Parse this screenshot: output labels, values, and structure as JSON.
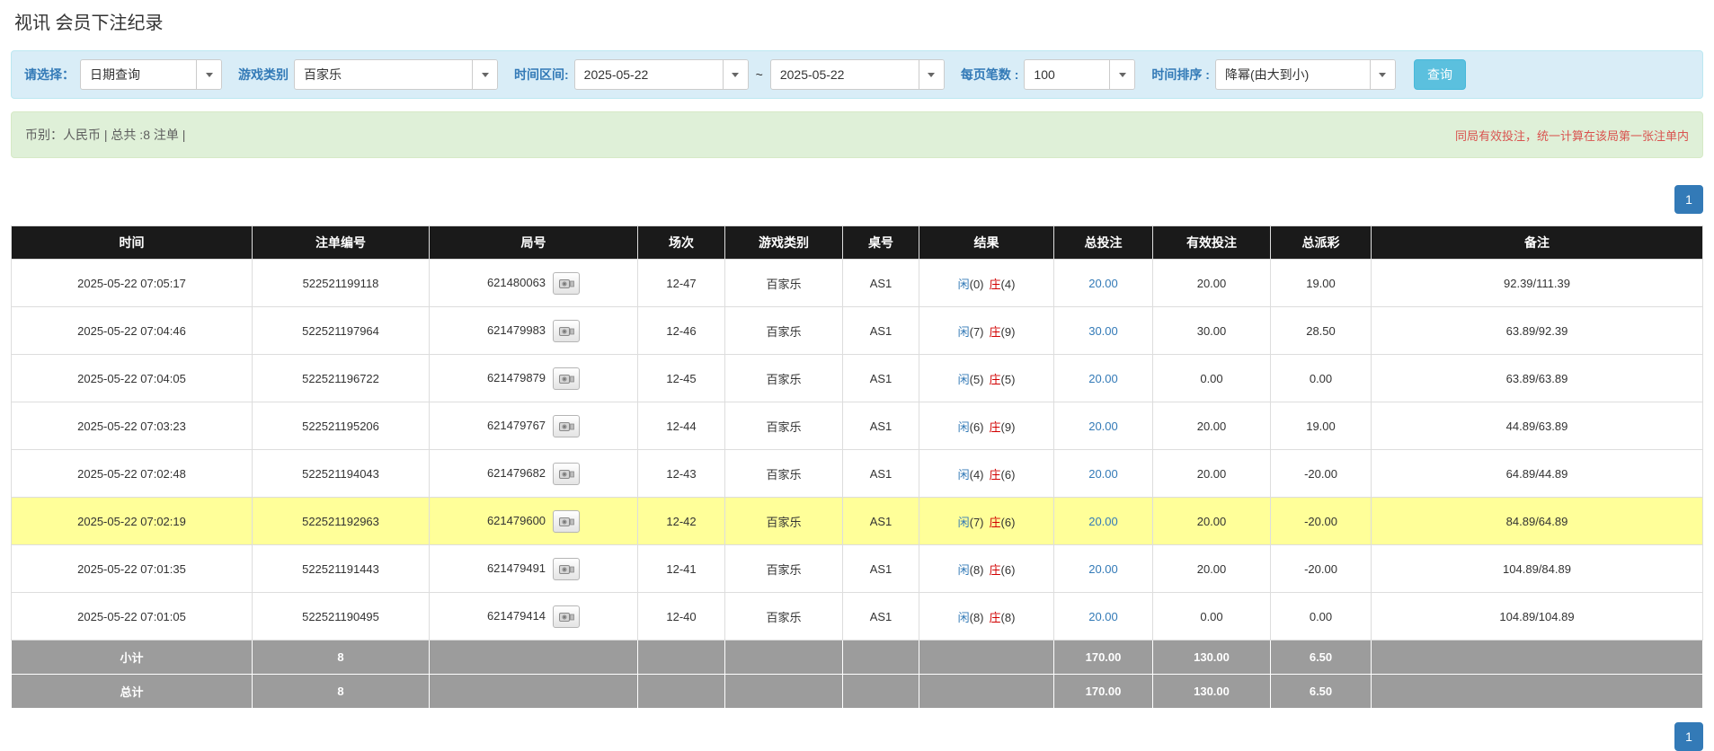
{
  "page": {
    "title": "视讯 会员下注纪录"
  },
  "filters": {
    "query_type_label": "请选择：",
    "query_type_value": "日期查询",
    "game_type_label": "游戏类别",
    "game_type_value": "百家乐",
    "time_range_label": "时间区间:",
    "date_from": "2025-05-22",
    "range_separator": "~",
    "date_to": "2025-05-22",
    "per_page_label": "每页笔数 :",
    "per_page_value": "100",
    "sort_label": "时间排序 :",
    "sort_value": "降幂(由大到小)",
    "search_button_label": "查询"
  },
  "summary": {
    "left_text": "币别：人民币 | 总共 :8 注单 |",
    "right_note": "同局有效投注，统一计算在该局第一张注单内"
  },
  "pagination": {
    "current_page": "1"
  },
  "table": {
    "headers": [
      "时间",
      "注单编号",
      "局号",
      "场次",
      "游戏类别",
      "桌号",
      "结果",
      "总投注",
      "有效投注",
      "总派彩",
      "备注"
    ],
    "rows": [
      {
        "time": "2025-05-22 07:05:17",
        "bet_id": "522521199118",
        "round": "621480063",
        "session": "12-47",
        "game": "百家乐",
        "table_no": "AS1",
        "result": {
          "p_label": "闲",
          "p_value": "(0)",
          "b_label": "庄",
          "b_value": "(4)"
        },
        "total_bet": "20.00",
        "valid_bet": "20.00",
        "payout": "19.00",
        "payout_negative": false,
        "highlight": false,
        "remark": "92.39/111.39"
      },
      {
        "time": "2025-05-22 07:04:46",
        "bet_id": "522521197964",
        "round": "621479983",
        "session": "12-46",
        "game": "百家乐",
        "table_no": "AS1",
        "result": {
          "p_label": "闲",
          "p_value": "(7)",
          "b_label": "庄",
          "b_value": "(9)"
        },
        "total_bet": "30.00",
        "valid_bet": "30.00",
        "payout": "28.50",
        "payout_negative": false,
        "highlight": false,
        "remark": "63.89/92.39"
      },
      {
        "time": "2025-05-22 07:04:05",
        "bet_id": "522521196722",
        "round": "621479879",
        "session": "12-45",
        "game": "百家乐",
        "table_no": "AS1",
        "result": {
          "p_label": "闲",
          "p_value": "(5)",
          "b_label": "庄",
          "b_value": "(5)"
        },
        "total_bet": "20.00",
        "valid_bet": "0.00",
        "payout": "0.00",
        "payout_negative": false,
        "highlight": false,
        "remark": "63.89/63.89"
      },
      {
        "time": "2025-05-22 07:03:23",
        "bet_id": "522521195206",
        "round": "621479767",
        "session": "12-44",
        "game": "百家乐",
        "table_no": "AS1",
        "result": {
          "p_label": "闲",
          "p_value": "(6)",
          "b_label": "庄",
          "b_value": "(9)"
        },
        "total_bet": "20.00",
        "valid_bet": "20.00",
        "payout": "19.00",
        "payout_negative": false,
        "highlight": false,
        "remark": "44.89/63.89"
      },
      {
        "time": "2025-05-22 07:02:48",
        "bet_id": "522521194043",
        "round": "621479682",
        "session": "12-43",
        "game": "百家乐",
        "table_no": "AS1",
        "result": {
          "p_label": "闲",
          "p_value": "(4)",
          "b_label": "庄",
          "b_value": "(6)"
        },
        "total_bet": "20.00",
        "valid_bet": "20.00",
        "payout": "-20.00",
        "payout_negative": true,
        "highlight": false,
        "remark": "64.89/44.89"
      },
      {
        "time": "2025-05-22 07:02:19",
        "bet_id": "522521192963",
        "round": "621479600",
        "session": "12-42",
        "game": "百家乐",
        "table_no": "AS1",
        "result": {
          "p_label": "闲",
          "p_value": "(7)",
          "b_label": "庄",
          "b_value": "(6)"
        },
        "total_bet": "20.00",
        "valid_bet": "20.00",
        "payout": "-20.00",
        "payout_negative": true,
        "highlight": true,
        "remark": "84.89/64.89"
      },
      {
        "time": "2025-05-22 07:01:35",
        "bet_id": "522521191443",
        "round": "621479491",
        "session": "12-41",
        "game": "百家乐",
        "table_no": "AS1",
        "result": {
          "p_label": "闲",
          "p_value": "(8)",
          "b_label": "庄",
          "b_value": "(6)"
        },
        "total_bet": "20.00",
        "valid_bet": "20.00",
        "payout": "-20.00",
        "payout_negative": true,
        "highlight": false,
        "remark": "104.89/84.89"
      },
      {
        "time": "2025-05-22 07:01:05",
        "bet_id": "522521190495",
        "round": "621479414",
        "session": "12-40",
        "game": "百家乐",
        "table_no": "AS1",
        "result": {
          "p_label": "闲",
          "p_value": "(8)",
          "b_label": "庄",
          "b_value": "(8)"
        },
        "total_bet": "20.00",
        "valid_bet": "0.00",
        "payout": "0.00",
        "payout_negative": false,
        "highlight": false,
        "remark": "104.89/104.89"
      }
    ],
    "footer": [
      {
        "label": "小计",
        "count": "8",
        "total_bet": "170.00",
        "valid_bet": "130.00",
        "payout": "6.50"
      },
      {
        "label": "总计",
        "count": "8",
        "total_bet": "170.00",
        "valid_bet": "130.00",
        "payout": "6.50"
      }
    ]
  },
  "colors": {
    "accent_blue": "#337ab7",
    "header_bg": "#1a1a1a",
    "highlight_row": "#ffff99",
    "negative_red": "#d10000",
    "search_button_bg": "#5bc0de",
    "filter_bar_bg": "#d9edf7",
    "summary_bar_bg": "#dff0d8",
    "footer_bg": "#9c9c9c"
  }
}
